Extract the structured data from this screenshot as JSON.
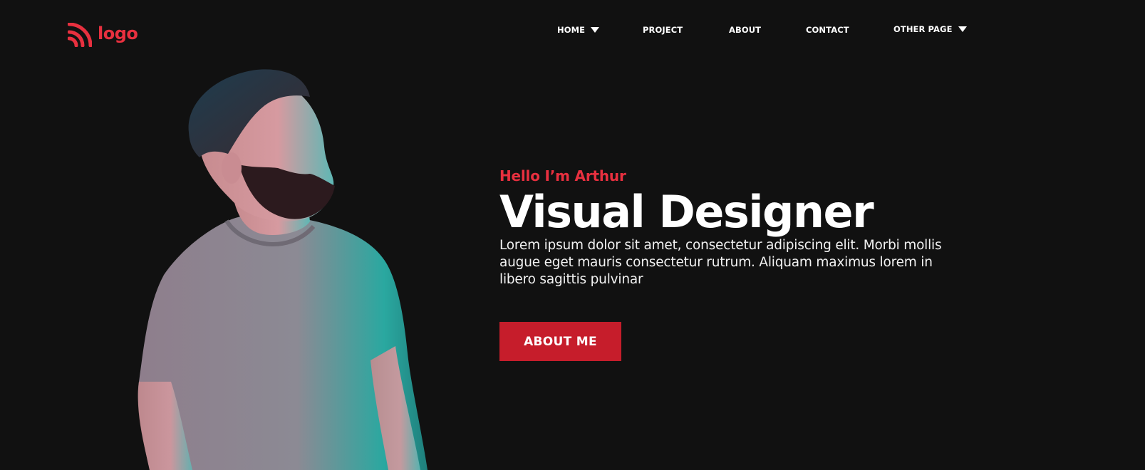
{
  "brand": {
    "logo_text": "logo",
    "logo_icon": "rss-feed-icon",
    "accent_color": "#e8303f",
    "button_color": "#c61d2b",
    "background_color": "#111111"
  },
  "nav": {
    "items": [
      {
        "label": "HOME",
        "has_dropdown": true
      },
      {
        "label": "PROJECT",
        "has_dropdown": false
      },
      {
        "label": "ABOUT",
        "has_dropdown": false
      },
      {
        "label": "CONTACT",
        "has_dropdown": false
      },
      {
        "label": "OTHER PAGE",
        "has_dropdown": true
      }
    ]
  },
  "hero": {
    "greeting": "Hello I’m Arthur",
    "title": "Visual Designer",
    "description": "Lorem ipsum dolor sit amet, consectetur adipiscing elit. Morbi mollis augue eget mauris consectetur rutrum. Aliquam maximus lorem in libero sagittis pulvinar",
    "cta_label": "ABOUT ME"
  }
}
